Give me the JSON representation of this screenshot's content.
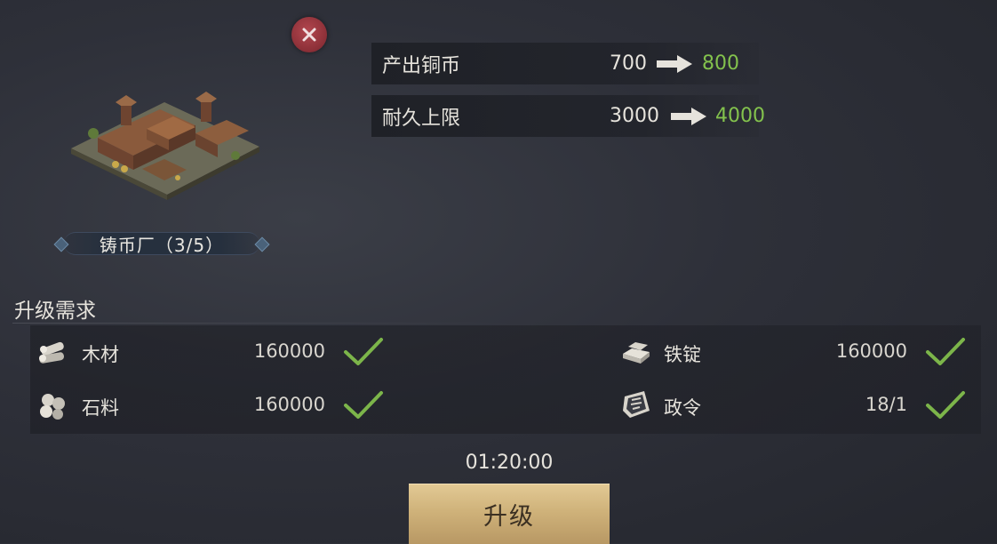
{
  "building": {
    "name": "铸币厂（3/5）"
  },
  "stats": [
    {
      "label": "产出铜币",
      "old": "700",
      "new": "800"
    },
    {
      "label": "耐久上限",
      "old": "3000",
      "new": "4000"
    }
  ],
  "requirements": {
    "title": "升级需求",
    "items": [
      {
        "name": "木材",
        "amount": "160000",
        "icon": "wood-icon",
        "met": true
      },
      {
        "name": "石料",
        "amount": "160000",
        "icon": "stone-icon",
        "met": true
      },
      {
        "name": "铁锭",
        "amount": "160000",
        "icon": "iron-ingot-icon",
        "met": true
      },
      {
        "name": "政令",
        "amount": "18/1",
        "icon": "decree-icon",
        "met": true
      }
    ]
  },
  "timer": "01:20:00",
  "upgrade_label": "升级",
  "colors": {
    "increase": "#83c24d",
    "check": "#7cb54a",
    "button": "#cfb27a",
    "close": "#8b2f37"
  }
}
